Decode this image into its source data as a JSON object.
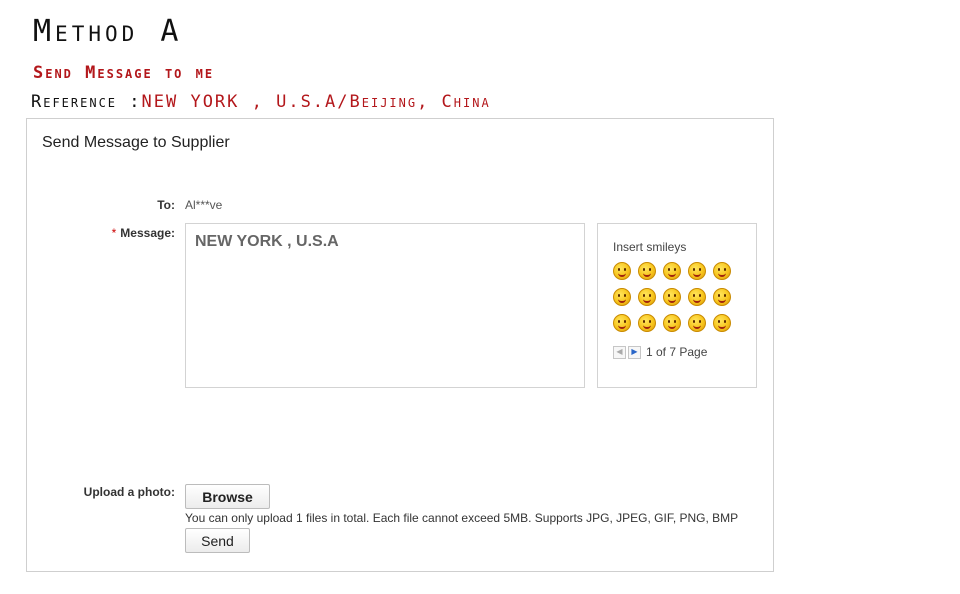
{
  "header": {
    "title": "Method A",
    "subtitle": "Send Message to me",
    "reference_label": "Reference :",
    "reference_value": "NEW YORK , U.S.A/Beijing, China"
  },
  "form": {
    "title": "Send Message to Supplier",
    "to_label": "To:",
    "to_value": "Al***ve",
    "required_mark": "*",
    "message_label": "Message:",
    "message_value": "NEW YORK , U.S.A",
    "upload_label": "Upload a photo:",
    "browse_label": "Browse",
    "upload_note": "You can only upload 1 files in total. Each file cannot exceed 5MB. Supports JPG, JPEG, GIF, PNG, BMP",
    "send_label": "Send"
  },
  "smileys": {
    "title": "Insert smileys",
    "icons": [
      "smiley-icon",
      "smiley-icon",
      "smiley-icon",
      "smiley-icon",
      "smiley-icon",
      "smiley-icon",
      "smiley-icon",
      "smiley-icon",
      "smiley-icon",
      "smiley-icon",
      "smiley-icon",
      "smiley-icon",
      "smiley-icon",
      "smiley-icon",
      "smiley-icon"
    ],
    "pager_text": "1 of 7 Page",
    "prev_icon": "arrow-left-icon",
    "next_icon": "arrow-right-icon"
  },
  "colors": {
    "accent_red": "#b3171b",
    "required_red": "#cc0000",
    "border": "#cfcfcf",
    "pager_blue": "#2a66c8"
  }
}
